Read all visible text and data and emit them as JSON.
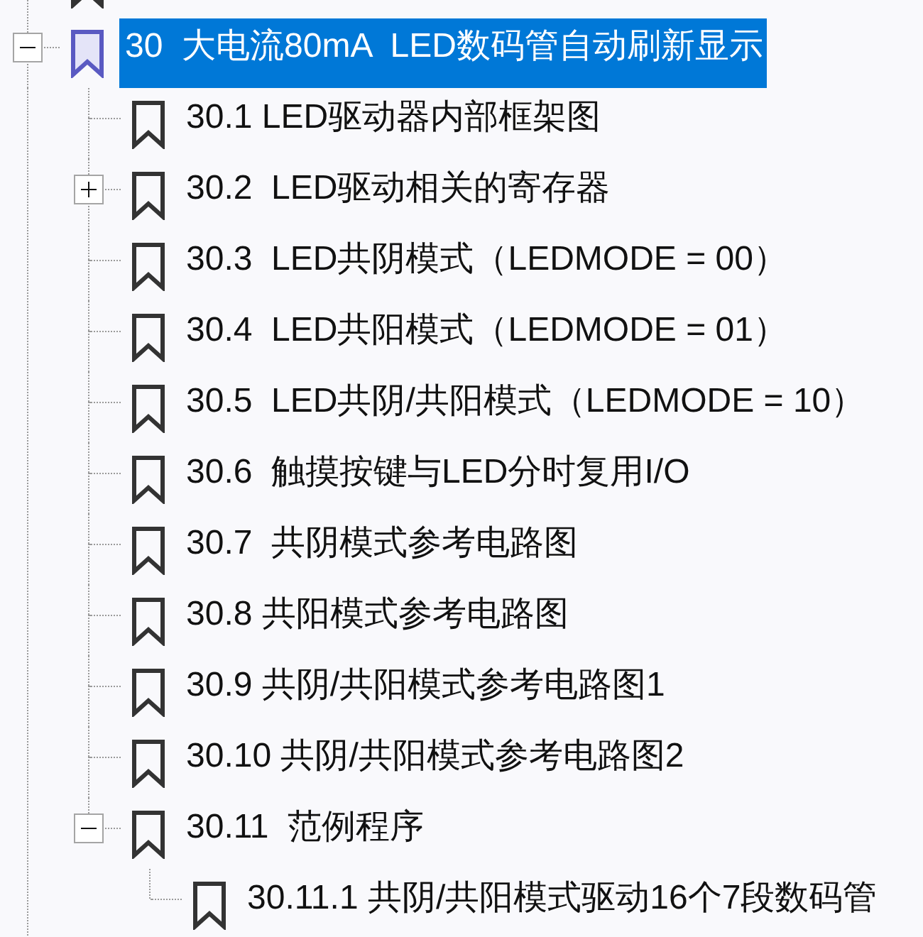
{
  "bookmarks": [
    {
      "label": "30  大电流80mA  LED数码管自动刷新显示",
      "selected": true,
      "expanded": true,
      "children": [
        {
          "label": "30.1 LED驱动器内部框架图",
          "selected": false
        },
        {
          "label": "30.2  LED驱动相关的寄存器",
          "selected": false,
          "expanded": false
        },
        {
          "label": "30.3  LED共阴模式（LEDMODE = 00）",
          "selected": false
        },
        {
          "label": "30.4  LED共阳模式（LEDMODE = 01）",
          "selected": false
        },
        {
          "label": "30.5  LED共阴/共阳模式（LEDMODE = 10）",
          "selected": false
        },
        {
          "label": "30.6  触摸按键与LED分时复用I/O",
          "selected": false
        },
        {
          "label": "30.7  共阴模式参考电路图",
          "selected": false
        },
        {
          "label": "30.8 共阳模式参考电路图",
          "selected": false
        },
        {
          "label": "30.9 共阴/共阳模式参考电路图1",
          "selected": false
        },
        {
          "label": "30.10 共阴/共阳模式参考电路图2",
          "selected": false
        },
        {
          "label": "30.11  范例程序",
          "selected": false,
          "expanded": true,
          "children": [
            {
              "label": "30.11.1 共阴/共阳模式驱动16个7段数码管",
              "selected": false
            }
          ]
        }
      ]
    }
  ]
}
